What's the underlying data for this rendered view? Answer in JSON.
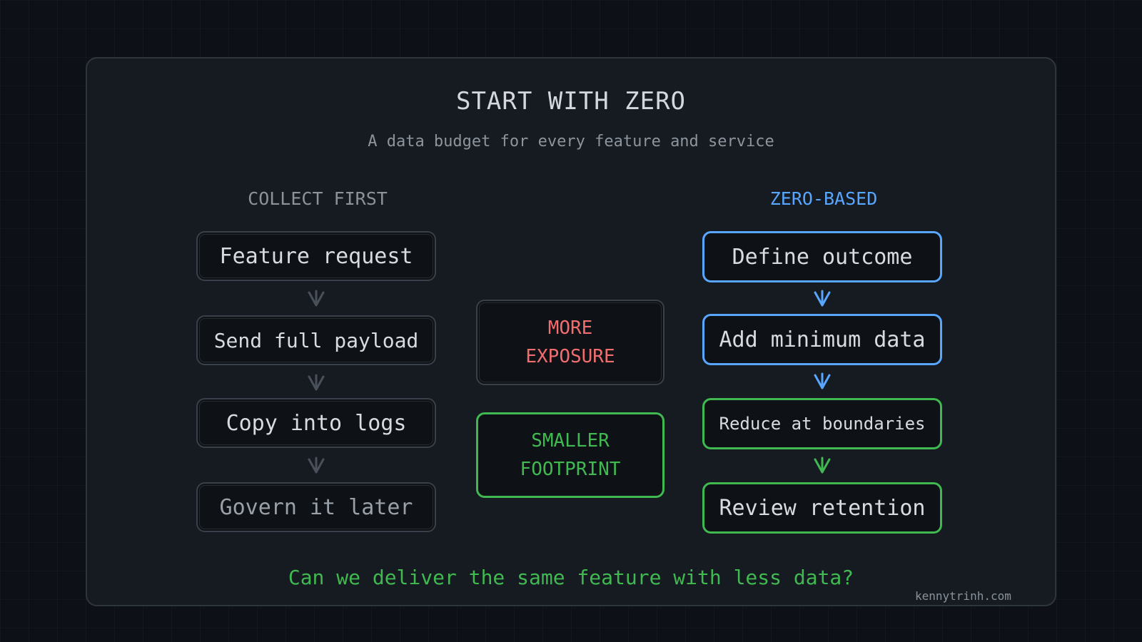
{
  "title": "START WITH ZERO",
  "subtitle": "A data budget for every feature and service",
  "left_column": {
    "heading": "COLLECT FIRST",
    "steps": [
      "Feature request",
      "Send full payload",
      "Copy into logs",
      "Govern it later"
    ]
  },
  "right_column": {
    "heading": "ZERO-BASED",
    "steps": [
      "Define outcome",
      "Add minimum data",
      "Reduce at boundaries",
      "Review retention"
    ]
  },
  "middle": {
    "top": [
      "MORE",
      "EXPOSURE"
    ],
    "bottom": [
      "SMALLER",
      "FOOTPRINT"
    ]
  },
  "question": "Can we deliver the same feature with less data?",
  "credit": "kennytrinh.com",
  "colors": {
    "background": "#0d1117",
    "card": "#161b22",
    "gray_border": "#3a4049",
    "blue": "#58a6ff",
    "green": "#3fb950",
    "red": "#f26d6d"
  }
}
